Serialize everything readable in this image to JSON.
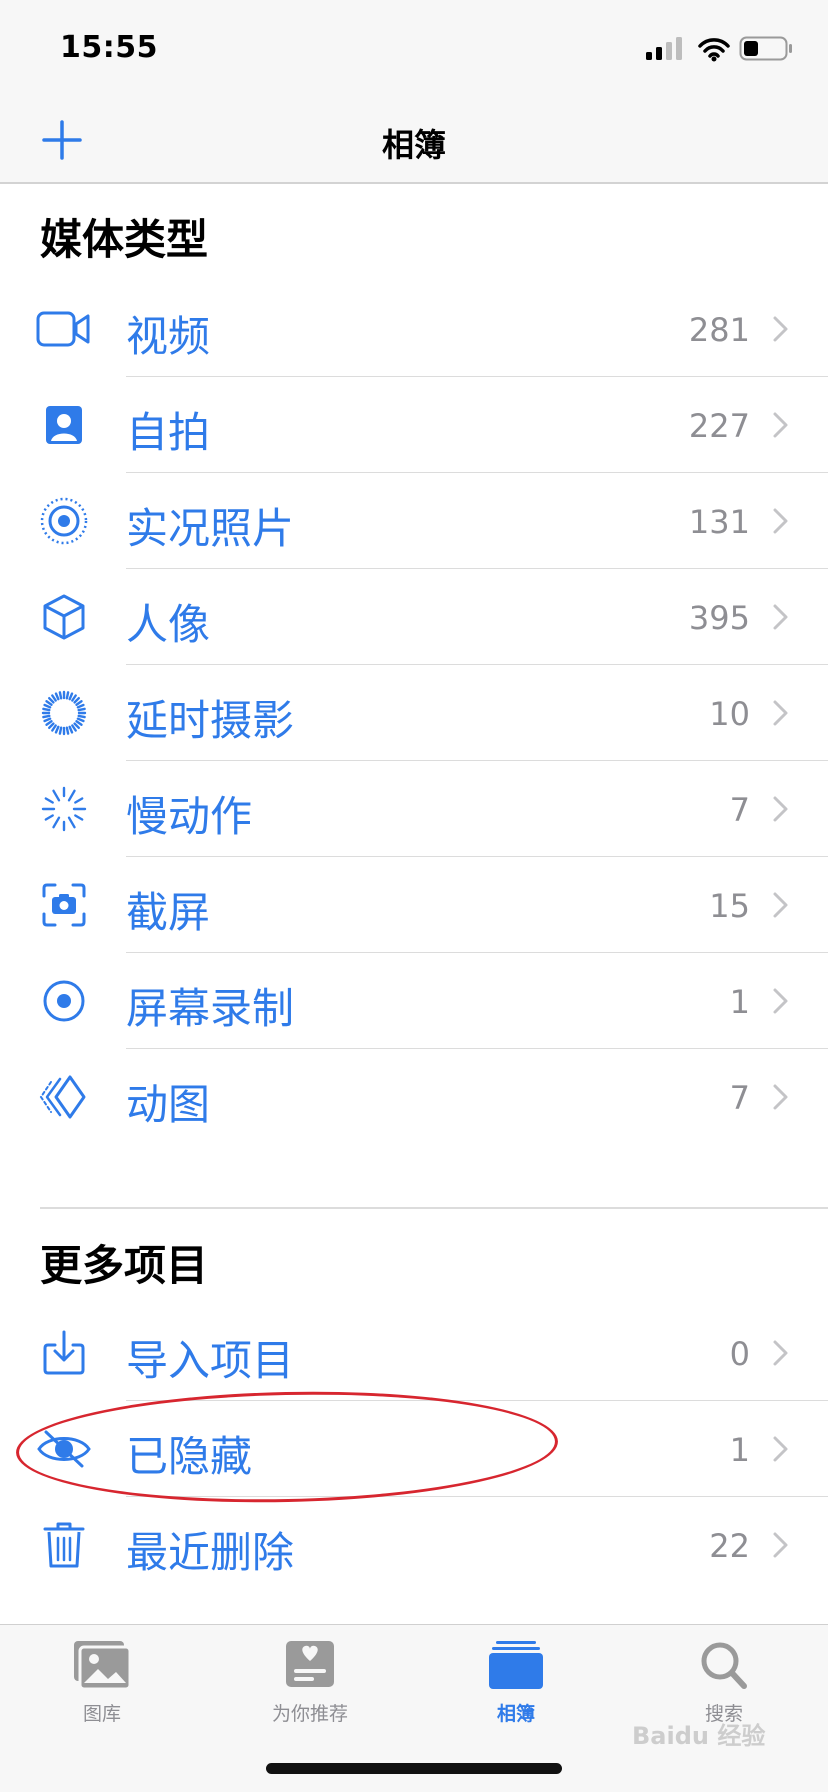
{
  "status": {
    "time": "15:55"
  },
  "nav": {
    "title": "相簿",
    "add_icon": "plus-icon"
  },
  "media_section": {
    "title": "媒体类型",
    "items": [
      {
        "label": "视频",
        "count": "281",
        "icon": "video-camera-icon"
      },
      {
        "label": "自拍",
        "count": "227",
        "icon": "portrait-person-icon"
      },
      {
        "label": "实况照片",
        "count": "131",
        "icon": "live-photo-icon"
      },
      {
        "label": "人像",
        "count": "395",
        "icon": "cube-icon"
      },
      {
        "label": "延时摄影",
        "count": "10",
        "icon": "timelapse-icon"
      },
      {
        "label": "慢动作",
        "count": "7",
        "icon": "slow-motion-icon"
      },
      {
        "label": "截屏",
        "count": "15",
        "icon": "screenshot-icon"
      },
      {
        "label": "屏幕录制",
        "count": "1",
        "icon": "screen-recording-icon"
      },
      {
        "label": "动图",
        "count": "7",
        "icon": "animated-layers-icon"
      }
    ]
  },
  "more_section": {
    "title": "更多项目",
    "items": [
      {
        "label": "导入项目",
        "count": "0",
        "icon": "import-tray-icon"
      },
      {
        "label": "已隐藏",
        "count": "1",
        "icon": "eye-slash-icon"
      },
      {
        "label": "最近删除",
        "count": "22",
        "icon": "trash-icon"
      }
    ]
  },
  "tabs": [
    {
      "label": "图库",
      "icon": "photos-library-icon",
      "active": false
    },
    {
      "label": "为你推荐",
      "icon": "for-you-icon",
      "active": false
    },
    {
      "label": "相簿",
      "icon": "albums-icon",
      "active": true
    },
    {
      "label": "搜索",
      "icon": "search-icon",
      "active": false
    }
  ],
  "watermark": "Baidu 经验",
  "colors": {
    "accent": "#2f7be9",
    "secondary_text": "#8e8e93",
    "highlight": "#d7262f"
  }
}
